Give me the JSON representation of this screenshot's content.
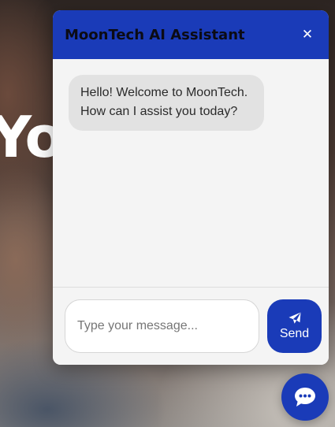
{
  "background": {
    "headline_fragment": "Yo"
  },
  "chat": {
    "title": "MoonTech AI Assistant",
    "close_icon": "close-icon",
    "messages": [
      {
        "sender": "bot",
        "text": "Hello! Welcome to MoonTech. How can I assist you today?"
      }
    ],
    "input": {
      "placeholder": "Type your message...",
      "value": ""
    },
    "send": {
      "label": "Send",
      "icon": "paper-plane-icon"
    }
  },
  "launcher": {
    "icon": "chat-bubble-icon"
  },
  "colors": {
    "primary": "#1a3bb8",
    "panel": "#f4f4f4",
    "bubble": "#e2e2e2"
  }
}
